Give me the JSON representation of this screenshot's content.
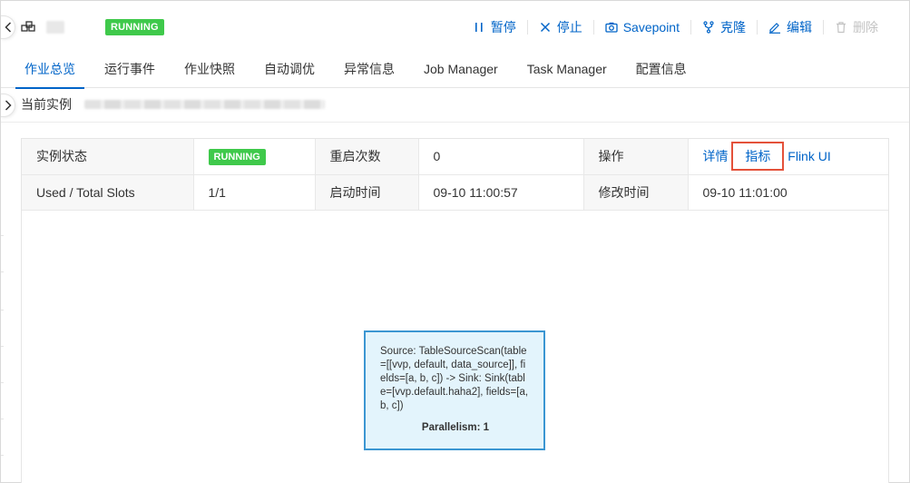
{
  "header": {
    "status": "RUNNING",
    "actions": [
      {
        "label": "暂停",
        "icon": "pause-icon",
        "enabled": true
      },
      {
        "label": "停止",
        "icon": "stop-icon",
        "enabled": true
      },
      {
        "label": "Savepoint",
        "icon": "camera-icon",
        "enabled": true
      },
      {
        "label": "克隆",
        "icon": "fork-icon",
        "enabled": true
      },
      {
        "label": "编辑",
        "icon": "edit-icon",
        "enabled": true
      },
      {
        "label": "删除",
        "icon": "trash-icon",
        "enabled": false
      }
    ]
  },
  "tabs": [
    {
      "label": "作业总览",
      "active": true
    },
    {
      "label": "运行事件"
    },
    {
      "label": "作业快照"
    },
    {
      "label": "自动调优"
    },
    {
      "label": "异常信息"
    },
    {
      "label": "Job Manager"
    },
    {
      "label": "Task Manager"
    },
    {
      "label": "配置信息"
    }
  ],
  "instance": {
    "label": "当前实例"
  },
  "info": {
    "row1": {
      "state_label": "实例状态",
      "state_value": "RUNNING",
      "restarts_label": "重启次数",
      "restarts_value": "0",
      "ops_label": "操作",
      "ops": [
        "详情",
        "指标",
        "Flink UI"
      ]
    },
    "row2": {
      "slots_label": "Used / Total Slots",
      "slots_value": "1/1",
      "start_label": "启动时间",
      "start_value": "09-10 11:00:57",
      "modified_label": "修改时间",
      "modified_value": "09-10 11:01:00"
    }
  },
  "graph": {
    "node_text": "Source: TableSourceScan(table=[[vvp, default, data_source]], fields=[a, b, c]) -> Sink: Sink(table=[vvp.default.haha2], fields=[a, b, c])",
    "parallelism": "Parallelism: 1"
  },
  "colors": {
    "accent": "#0064c8",
    "running": "#3fc94b",
    "highlight_box": "#e4513a",
    "node_border": "#3b96d2",
    "node_fill": "#e3f4fc"
  }
}
